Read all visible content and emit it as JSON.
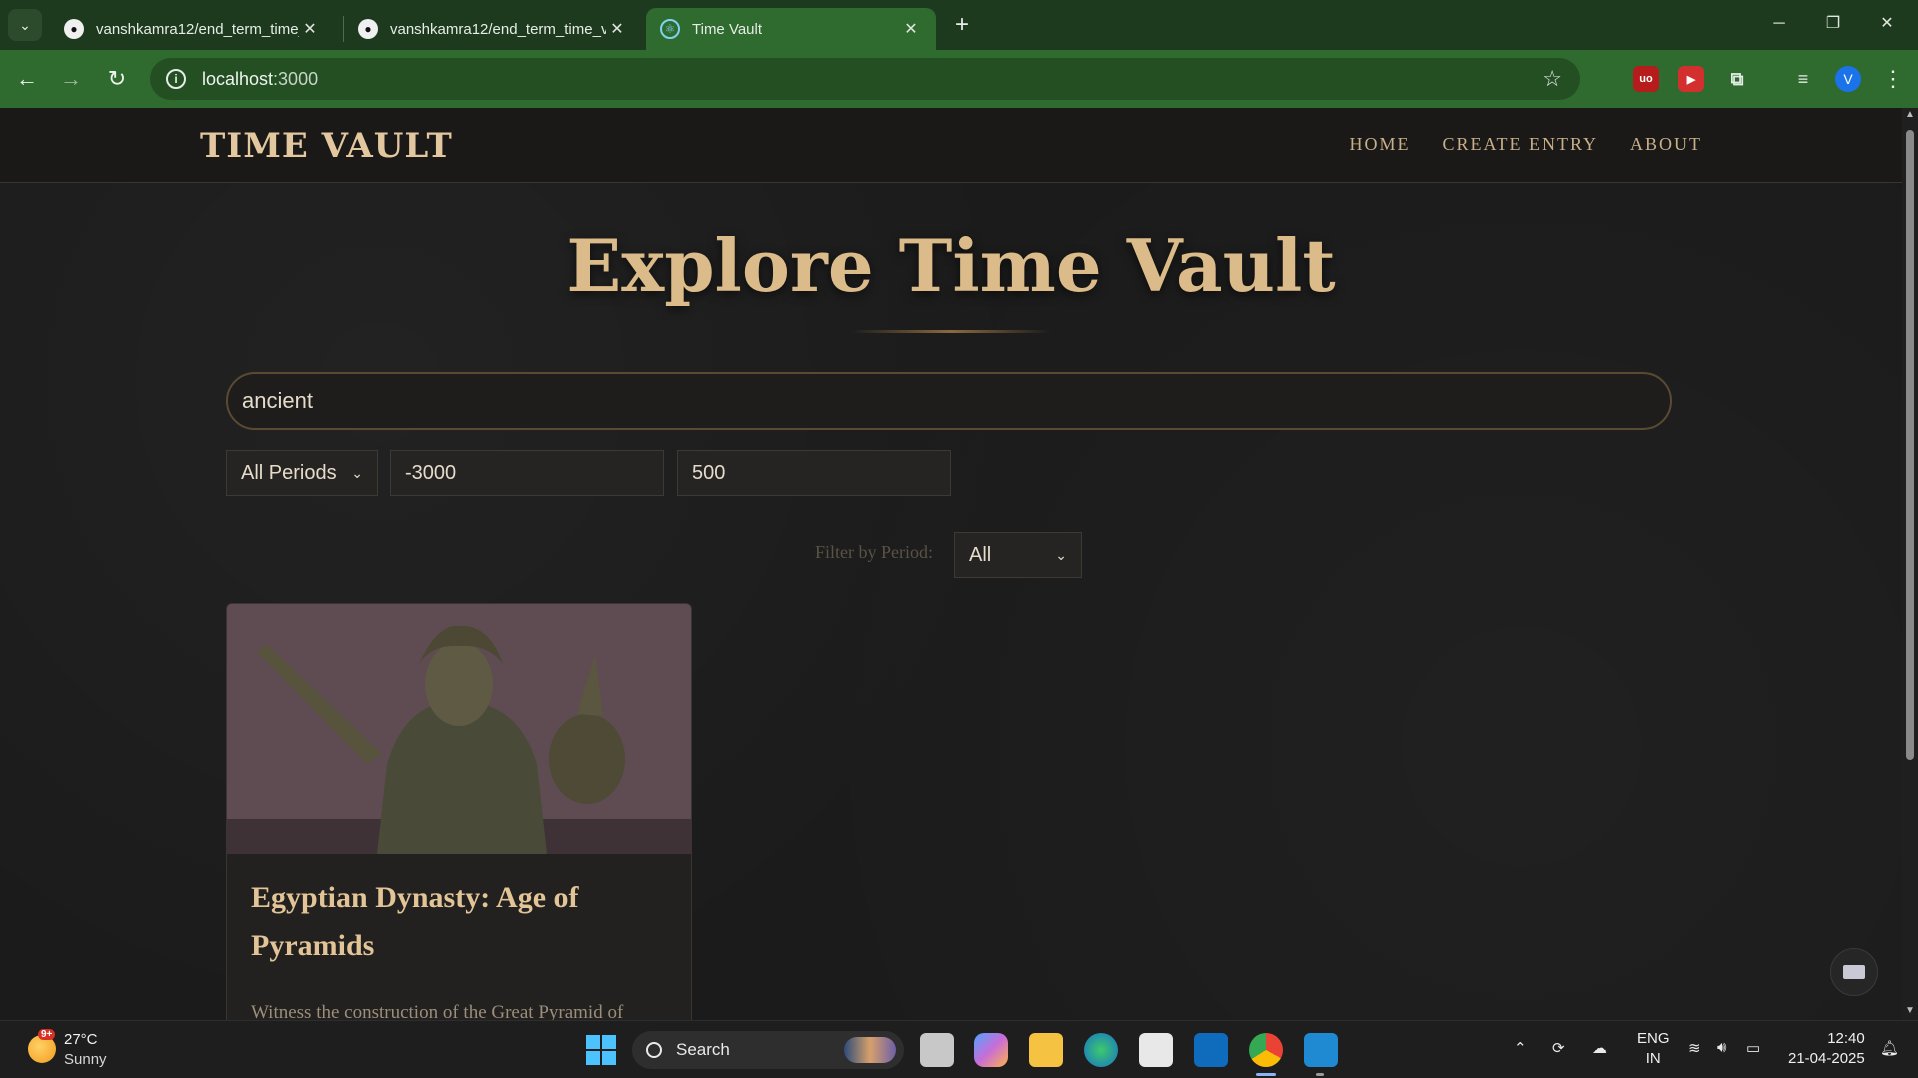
{
  "browser": {
    "tabs": [
      {
        "title": "vanshkamra12/end_term_time_v",
        "active": false
      },
      {
        "title": "vanshkamra12/end_term_time_v",
        "active": false
      },
      {
        "title": "Time Vault",
        "active": true
      }
    ],
    "url_host": "localhost",
    "url_port": ":3000",
    "avatar_letter": "V"
  },
  "site": {
    "brand": "TIME VAULT",
    "nav": [
      "HOME",
      "CREATE ENTRY",
      "ABOUT"
    ],
    "hero_title": "Explore Time Vault",
    "search_value": "ancient",
    "period_select": "All Periods",
    "year_from": "-3000",
    "year_to": "500",
    "filter_label": "Filter by Period:",
    "filter_value": "All",
    "card": {
      "title": "Egyptian Dynasty: Age of Pyramids",
      "description": "Witness the construction of the Great Pyramid of"
    }
  },
  "taskbar": {
    "weather_temp": "27°C",
    "weather_cond": "Sunny",
    "weather_badge": "9+",
    "search_label": "Search",
    "lang_line1": "ENG",
    "lang_line2": "IN",
    "time": "12:40",
    "date": "21-04-2025"
  },
  "colors": {
    "accent_gold": "#dcbb8a",
    "browser_green": "#2f6a2f",
    "page_bg": "#1b1b1b"
  }
}
